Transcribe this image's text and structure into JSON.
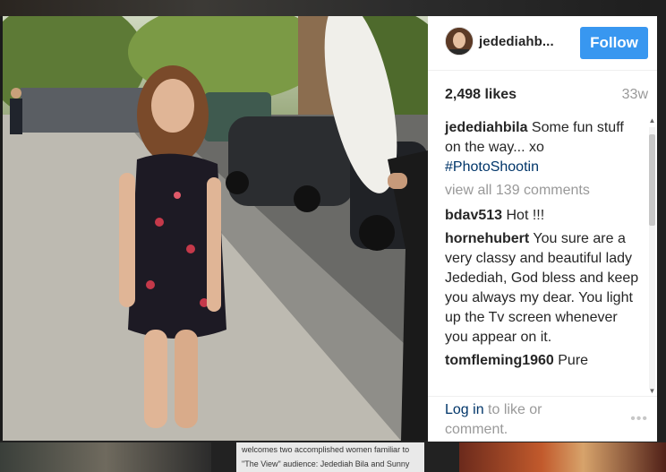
{
  "post": {
    "username": "jedediahb...",
    "follow_label": "Follow",
    "likes": "2,498 likes",
    "age": "33w",
    "caption": {
      "user": "jedediahbila",
      "text": " Some fun stuff on the way... xo ",
      "hashtag": "#PhotoShootin"
    },
    "view_all": "view all 139 comments",
    "comments": [
      {
        "user": "bdav513",
        "text": " Hot !!!"
      },
      {
        "user": "hornehubert",
        "text": " You sure are a very classy and beautiful lady Jedediah, God bless and keep you always my dear. You light up the Tv screen whenever you appear on it."
      },
      {
        "user": "tomfleming1960",
        "text": " Pure"
      }
    ],
    "footer": {
      "login_link": "Log in",
      "login_rest": " to like or comment.",
      "more": "•••"
    }
  },
  "background": {
    "caption_text": "welcomes two accomplished women familiar to \"The View\" audience: Jedediah Bila and Sunny"
  },
  "colors": {
    "follow_bg": "#3897f0",
    "link": "#003569",
    "muted": "#999999"
  }
}
